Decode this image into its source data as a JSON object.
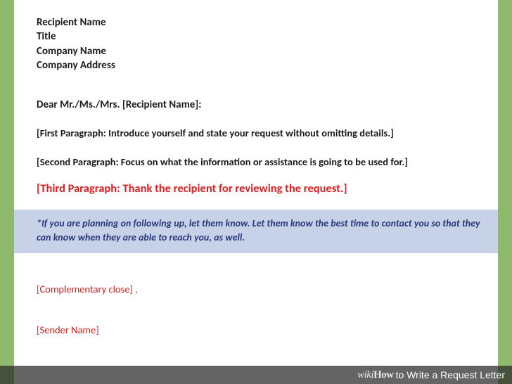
{
  "header": {
    "line1": "Recipient Name",
    "line2": "Title",
    "line3": "Company Name",
    "line4": "Company Address"
  },
  "salutation": "Dear Mr./Ms./Mrs. [Recipient Name]:",
  "paragraphs": {
    "first": "[First Paragraph: Introduce yourself and state your request without omitting details.]",
    "second": "[Second Paragraph: Focus on what the information or assistance is going to be used for.]",
    "third": "[Third Paragraph: Thank the recipient for reviewing the request.]"
  },
  "note": "*If you are planning on following up, let them know. Let them know the best time to contact you so that they can know when they are able to reach you, as well.",
  "close": "[Complementary close] ,",
  "sender": "[Sender Name]",
  "caption": {
    "brand_prefix": "wiki",
    "brand_suffix": "How",
    "title": " to Write a Request Letter"
  }
}
